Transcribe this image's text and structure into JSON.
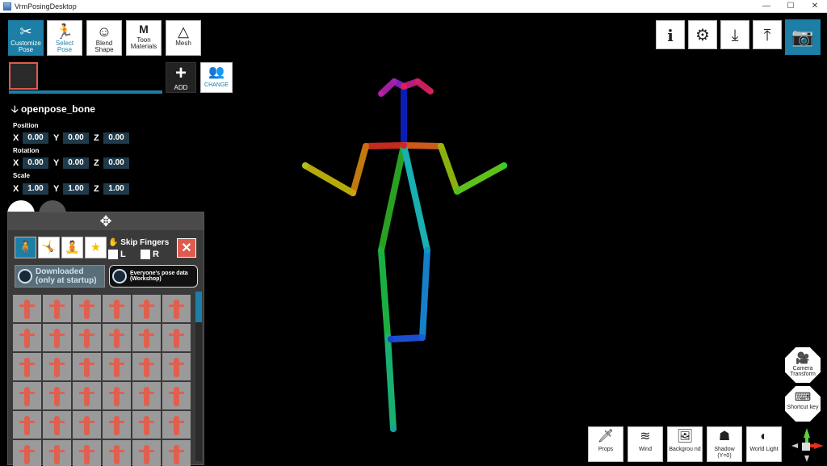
{
  "window": {
    "title": "VrmPosingDesktop",
    "controls": [
      "—",
      "☐",
      "✕"
    ]
  },
  "toolbar": [
    {
      "label": "Customize Pose",
      "icon": "customize-pose-icon",
      "glyph": "✂",
      "active": true
    },
    {
      "label": "Select Pose",
      "icon": "select-pose-icon",
      "glyph": "🏃",
      "active": false
    },
    {
      "label": "Blend Shape",
      "icon": "face-icon",
      "glyph": "☺",
      "active": false
    },
    {
      "label": "Toon Materials",
      "icon": "toon-materials-icon",
      "glyph": "M",
      "active": false
    },
    {
      "label": "Mesh",
      "icon": "mesh-icon",
      "glyph": "△",
      "active": false
    }
  ],
  "preset": {
    "add_label": "ADD",
    "change_label": "CHANGE"
  },
  "bone": {
    "name": "openpose_bone",
    "position_label": "Position",
    "rotation_label": "Rotation",
    "scale_label": "Scale",
    "position": {
      "x": "0.00",
      "y": "0.00",
      "z": "0.00"
    },
    "rotation": {
      "x": "0.00",
      "y": "0.00",
      "z": "0.00"
    },
    "scale": {
      "x": "1.00",
      "y": "1.00",
      "z": "1.00"
    }
  },
  "pose_panel": {
    "move_glyph": "✥",
    "skip_fingers_label": "Skip Fingers",
    "left_label": "L",
    "right_label": "R",
    "close_glyph": "✕",
    "downloaded_label": "Downloaded (only at startup)",
    "workshop_label": "Everyone's pose data (Workshop)",
    "grid_count": 36
  },
  "top_right": {
    "info_glyph": "i",
    "settings_glyph": "⚙",
    "import_glyph": "⤓",
    "export_glyph": "⤒",
    "screenshot_glyph": "📷"
  },
  "side": {
    "camera_label": "Camera Transform",
    "shortcut_label": "Shortcut key"
  },
  "bottom": [
    {
      "label": "Props",
      "icon": "props-icon",
      "glyph": "🗡"
    },
    {
      "label": "Wind",
      "icon": "wind-icon",
      "glyph": "≋"
    },
    {
      "label": "Backgrou nd",
      "icon": "background-icon",
      "glyph": "🖼"
    },
    {
      "label": "Shadow (Y=0)",
      "icon": "shadow-icon",
      "glyph": "☗"
    },
    {
      "label": "World Light",
      "icon": "light-icon",
      "glyph": "◐"
    }
  ],
  "colors": {
    "accent": "#1d7ea6",
    "close": "#e05a4e"
  }
}
